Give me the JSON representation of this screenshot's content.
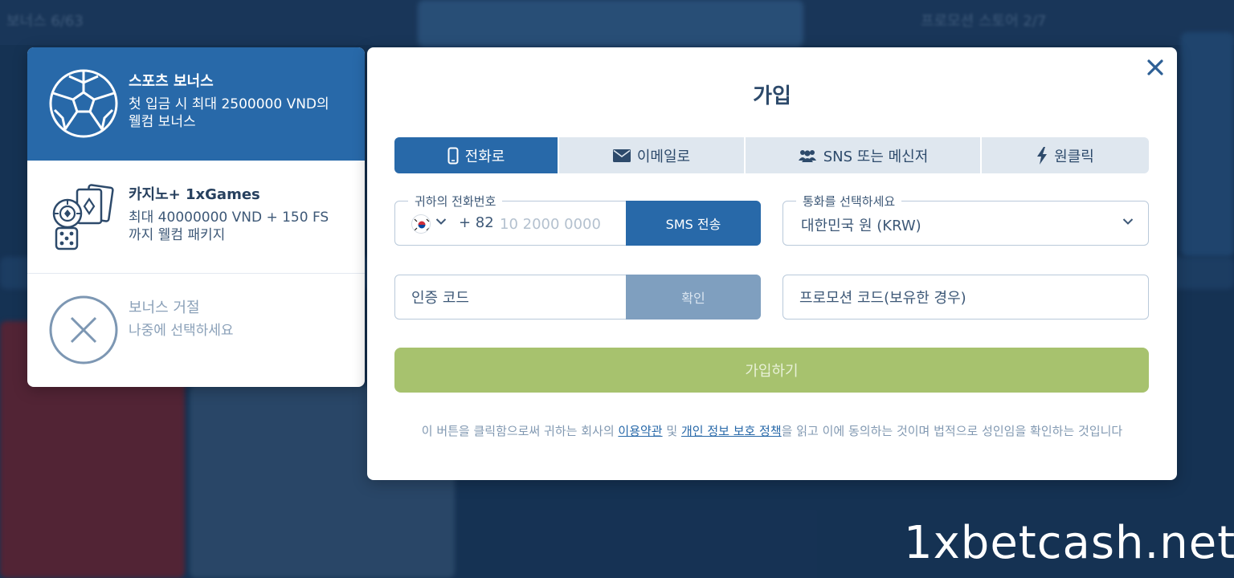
{
  "background": {
    "top_left_text": "보너스 6/63",
    "top_right_text": "프로모션 스토어 2/7"
  },
  "bonuses": [
    {
      "title": "스포츠 보너스",
      "desc1": "첫 입금 시 최대 2500000 VND의",
      "desc2": "웰컴 보너스",
      "icon": "soccer-ball-icon",
      "selected": true
    },
    {
      "title": "카지노+ 1xGames",
      "desc1": "최대 40000000 VND + 150 FS",
      "desc2": "까지 웰컴 패키지",
      "icon": "casino-icon",
      "selected": false
    },
    {
      "title": "보너스 거절",
      "desc1": "나중에 선택하세요",
      "icon": "decline-icon",
      "selected": false
    }
  ],
  "modal": {
    "title": "가입",
    "close_icon": "close-icon",
    "tabs": [
      {
        "label": "전화로",
        "icon": "phone-icon",
        "active": true
      },
      {
        "label": "이메일로",
        "icon": "envelope-icon",
        "active": false
      },
      {
        "label": "SNS 또는 메신저",
        "icon": "users-icon",
        "active": false
      },
      {
        "label": "원클릭",
        "icon": "lightning-icon",
        "active": false
      }
    ],
    "phone": {
      "label": "귀하의 전화번호",
      "dial_code": "+ 82",
      "placeholder": "10 2000 0000",
      "value": "",
      "flag_icon": "korea-flag-icon",
      "sms_button": "SMS 전송"
    },
    "currency": {
      "label": "통화를 선택하세요",
      "selected": "대한민국 원 (KRW)"
    },
    "code": {
      "placeholder": "인증 코드",
      "confirm_button": "확인"
    },
    "promo": {
      "placeholder": "프로모션 코드(보유한 경우)"
    },
    "submit_button": "가입하기",
    "disclaimer": {
      "part1": "이 버튼을 클릭함으로써 귀하는 회사의 ",
      "terms_link": "이용약관",
      "part2": " 및 ",
      "privacy_link": "개인 정보 보호 정책",
      "part3": "을 읽고 이에 동의하는 것이며 법적으로 성인임을 확인하는 것입니다"
    }
  },
  "colors": {
    "primary": "#2869a9",
    "submit": "#a7c26e",
    "confirm_disabled": "#7f9fbf",
    "text": "#3d5877"
  },
  "watermark": "1xbetcash.net"
}
